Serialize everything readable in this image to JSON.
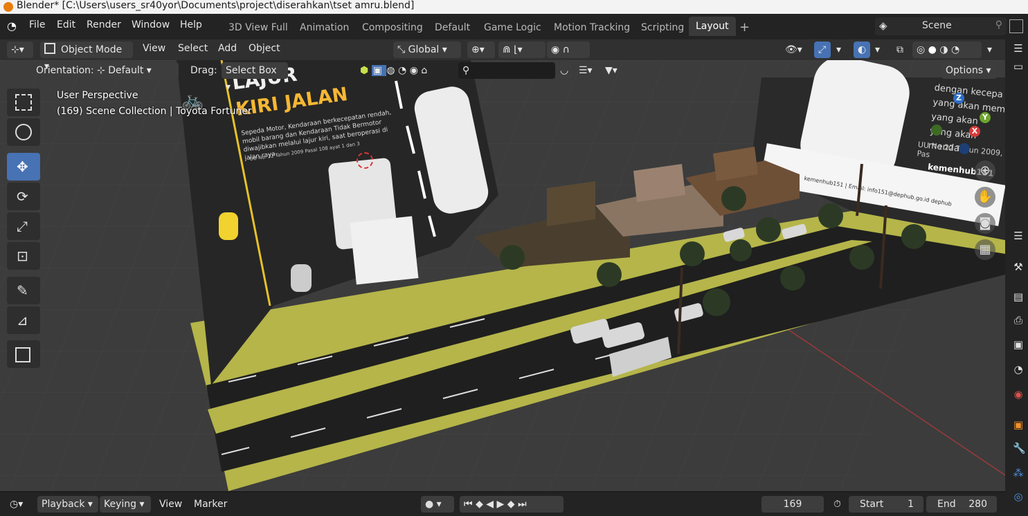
{
  "window": {
    "title": "Blender* [C:\\Users\\users_sr40yor\\Documents\\project\\diserahkan\\tset amru.blend]"
  },
  "menu": [
    "File",
    "Edit",
    "Render",
    "Window",
    "Help"
  ],
  "workspaces": [
    "3D View Full",
    "Animation",
    "Compositing",
    "Default",
    "Game Logic",
    "Motion Tracking",
    "Scripting",
    "Layout"
  ],
  "active_workspace": "Layout",
  "scene": {
    "label": "Scene"
  },
  "header": {
    "mode": "Object Mode",
    "menus": [
      "View",
      "Select",
      "Add",
      "Object"
    ],
    "transform": "Global",
    "options": "Options"
  },
  "toolheader": {
    "orientation_label": "Orientation:",
    "orientation_value": "Default",
    "drag_label": "Drag:",
    "drag_value": "Select Box"
  },
  "viewport": {
    "perspective": "User Perspective",
    "collection": "(169) Scene Collection | Toyota Fortuner"
  },
  "billboard_left": {
    "title1": "LAJUR",
    "title2": "KIRI JALAN",
    "body": "Sepeda Motor, Kendaraan berkecepatan rendah, mobil barang dan Kendaraan Tidak Bermotor diwajibkan melalui lajur kiri, saat beroperasi di jalan raya.",
    "law": "UU No. 22 Tahun 2009  Pasal 108 ayat 1 dan 3"
  },
  "billboard_right": {
    "lines": [
      "dengan kecepa",
      "yang akan mem",
      "yang akan",
      "yang akan menda"
    ],
    "law": "UU No 22 Tahun 2009, Pas",
    "brand": "kemenhub151",
    "footer": "kemenhub151 | Email: info151@dephub.go.id  dephub"
  },
  "gizmo": {
    "x": "X",
    "y": "Y",
    "z": "Z"
  },
  "timeline": {
    "menus": [
      "Playback",
      "Keying",
      "View",
      "Marker"
    ],
    "current_frame": "169",
    "start_label": "Start",
    "start_value": "1",
    "end_label": "End",
    "end_value": "280"
  },
  "colors": {
    "accent": "#4772b3",
    "ground": "#b5b54a",
    "road": "#1f1f1f"
  }
}
